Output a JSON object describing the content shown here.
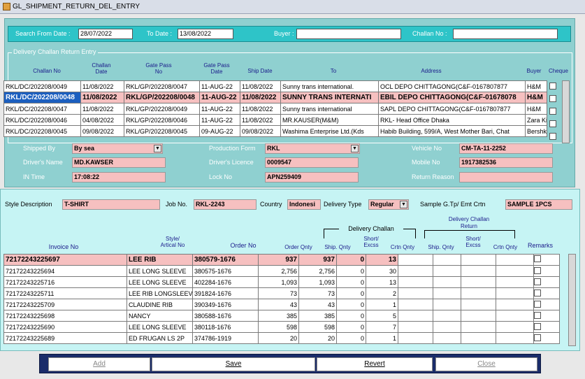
{
  "window": {
    "title": "GL_SHIPMENT_RETURN_DEL_ENTRY"
  },
  "search": {
    "from_label": "Search From Date :",
    "from_value": "28/07/2022",
    "to_label": "To Date :",
    "to_value": "13/08/2022",
    "buyer_label": "Buyer :",
    "buyer_value": "",
    "challan_label": "Challan No :",
    "challan_value": ""
  },
  "group_title": "Delivery Challan Return Entry",
  "challan_headers": {
    "challan_no": "Challan No",
    "challan_date_1": "Challan",
    "challan_date_2": "Date",
    "gate_pass_1": "Gate Pass",
    "gate_pass_2": "No",
    "gate_pass_date_1": "Gate Pass",
    "gate_pass_date_2": "Date",
    "ship_date": "Ship Date",
    "to": "To",
    "address": "Address",
    "buyer": "Buyer",
    "cheque": "Cheque"
  },
  "challan_rows": [
    [
      "RKL/DC/202208/0049",
      "11/08/2022",
      "RKL/GP/202208/0047",
      "11-AUG-22",
      "11/08/2022",
      "Sunny trans international.",
      "OCL DEPO CHITTAGONG(C&F-0167807877",
      "H&M"
    ],
    [
      "RKL/DC/202208/0048",
      "11/08/2022",
      "RKL/GP/202208/0048",
      "11-AUG-22",
      "11/08/2022",
      "SUNNY TRANS INTERNATI",
      "EBIL DEPO CHITTAGONG(C&F-01678078",
      "H&M"
    ],
    [
      "RKL/DC/202208/0047",
      "11/08/2022",
      "RKL/GP/202208/0049",
      "11-AUG-22",
      "11/08/2022",
      "Sunny trans international",
      "SAPL DEPO CHITTAGONG(C&F-0167807877",
      "H&M"
    ],
    [
      "RKL/DC/202208/0046",
      "04/08/2022",
      "RKL/GP/202208/0046",
      "11-AUG-22",
      "11/08/2022",
      "MR.KAUSER(M&M)",
      "RKL- Head Office Dhaka",
      "Zara Kids"
    ],
    [
      "RKL/DC/202208/0045",
      "09/08/2022",
      "RKL/GP/202208/0045",
      "09-AUG-22",
      "09/08/2022",
      "Washima Enterprise Ltd.(Kds",
      "Habib Building, 599/A, West Mother Bari, Chat",
      "Bershka"
    ]
  ],
  "details": {
    "shipped_by_label": "Shipped By",
    "shipped_by_value": "By sea",
    "production_form_label": "Production Form",
    "production_form_value": "RKL",
    "vehicle_no_label": "Vehicle No",
    "vehicle_no_value": "CM-TA-11-2252",
    "drivers_name_label": "Driver's Name",
    "drivers_name_value": "MD.KAWSER",
    "drivers_licence_label": "Driver's Licence",
    "drivers_licence_value": "0009547",
    "mobile_no_label": "Mobile  No",
    "mobile_no_value": "1917382536",
    "in_time_label": "IN Time",
    "in_time_value": "17:08:22",
    "lock_no_label": "Lock No",
    "lock_no_value": "APN259409",
    "return_reason_label": "Return Reason",
    "return_reason_value": ""
  },
  "style_info": {
    "style_desc_label": "Style Description",
    "style_desc_value": "T-SHIRT",
    "job_no_label": "Job No.",
    "job_no_value": "RKL-2243",
    "country_label": "Country",
    "country_value": "Indonesi",
    "delivery_type_label": "Delivery Type",
    "delivery_type_value": "Regular",
    "sample_label": "Sample G.Tp/  Emt Crtn",
    "sample_value": "SAMPLE 1PCS"
  },
  "invoice_headers": {
    "invoice_no": "Invoice No",
    "style_1": "Style/",
    "style_2": "Artical No",
    "order_no": "Order No",
    "order_qnty": "Order Qnty",
    "delivery_challan": "Delivery Challan",
    "ship_qnty": "Ship. Qnty",
    "short_excs_1": "Short/",
    "short_excs_2": "Excss",
    "crtn_qnty": "Crtn Qnty",
    "return_1": "Delivery Challan",
    "return_2": "Return",
    "r_ship_qnty": "Ship. Qnty",
    "r_short_1": "Short/",
    "r_short_2": "Excss",
    "r_crtn_qnty": "Crtn Qnty",
    "remarks": "Remarks"
  },
  "invoice_rows": [
    [
      "72172243225697",
      "LEE RIB",
      "380579-1676",
      "937",
      "937",
      "0",
      "13"
    ],
    [
      "72172243225694",
      "LEE LONG SLEEVE",
      "380575-1676",
      "2,756",
      "2,756",
      "0",
      "30"
    ],
    [
      "72172243225716",
      "LEE LONG SLEEVE",
      "402284-1676",
      "1,093",
      "1,093",
      "0",
      "13"
    ],
    [
      "72172243225711",
      "LEE RIB LONGSLEEVE",
      "391824-1676",
      "73",
      "73",
      "0",
      "2"
    ],
    [
      "72172243225709",
      "CLAUDINE RIB",
      "390349-1676",
      "43",
      "43",
      "0",
      "1"
    ],
    [
      "72172243225698",
      "NANCY",
      "380588-1676",
      "385",
      "385",
      "0",
      "5"
    ],
    [
      "72172243225690",
      "LEE LONG SLEEVE",
      "380118-1676",
      "598",
      "598",
      "0",
      "7"
    ],
    [
      "72172243225689",
      "ED FRUGAN LS 2P",
      "374786-1919",
      "20",
      "20",
      "0",
      "1"
    ]
  ],
  "buttons": {
    "add": "Add",
    "save": "Save",
    "revert": "Revert",
    "close": "Close"
  },
  "colors": {
    "teal_panel": "#8fd0d0",
    "search_bar": "#2ec4c8",
    "pink_field": "#f6c0c0",
    "selection_blue": "#1c5fbf",
    "button_bar": "#1a2c6a"
  }
}
